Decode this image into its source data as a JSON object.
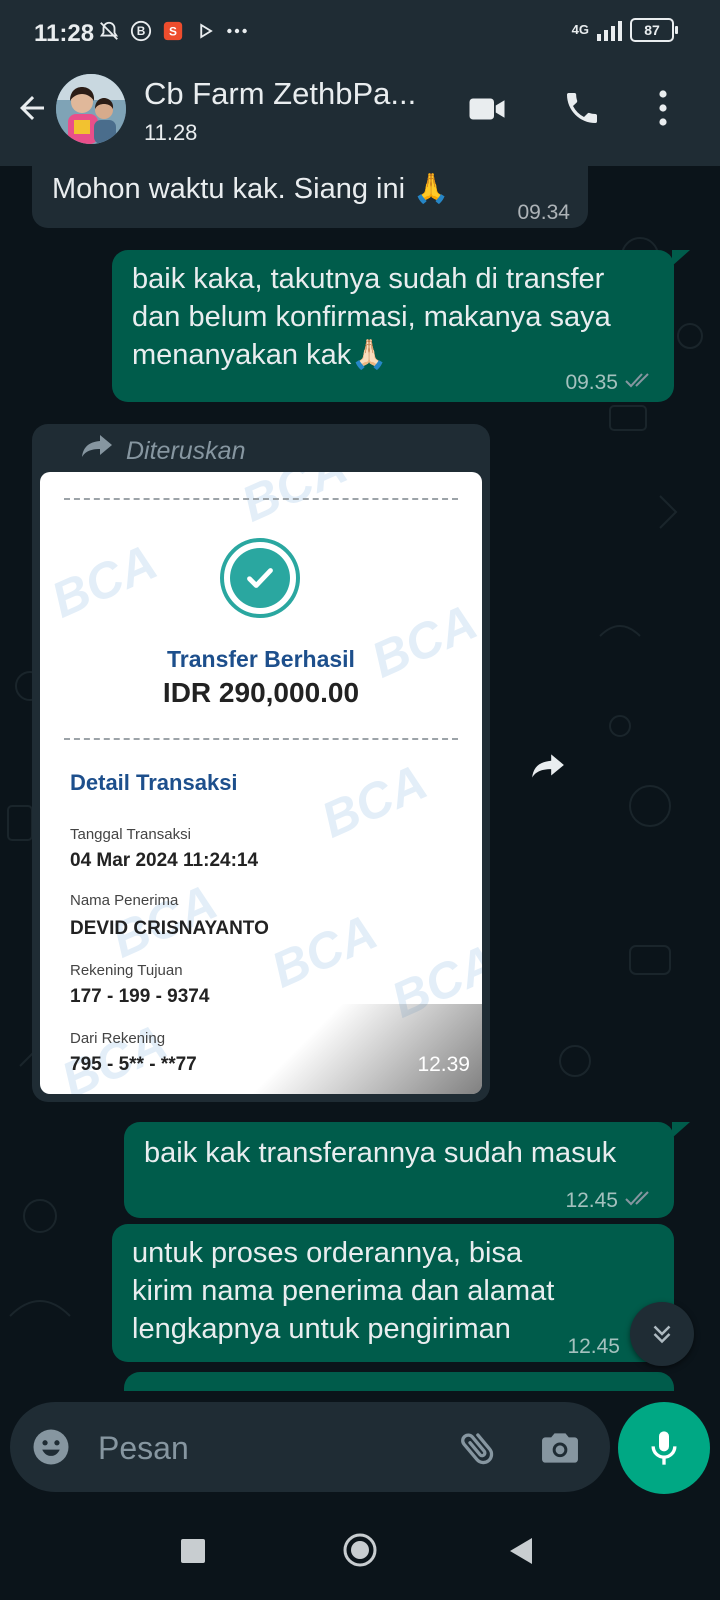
{
  "status_bar": {
    "time": "11:28",
    "network": "4G",
    "battery": "87"
  },
  "header": {
    "contact_name": "Cb Farm ZethbPa...",
    "last_seen": "11.28"
  },
  "messages": [
    {
      "direction": "incoming",
      "text": "Mohon waktu kak. Siang ini 🙏",
      "time": "09.34"
    },
    {
      "direction": "outgoing",
      "text": "baik kaka, takutnya sudah di transfer\ndan belum konfirmasi, makanya saya\nmenanyakan kak🙏🏻",
      "time": "09.35",
      "status": "read"
    },
    {
      "direction": "outgoing",
      "text": "baik kak transferannya sudah masuk",
      "time": "12.45",
      "status": "read"
    },
    {
      "direction": "outgoing",
      "text": "untuk proses orderannya, bisa\nkirim nama penerima dan alamat\nlengkapnya untuk pengiriman",
      "time": "12.45"
    }
  ],
  "forwarded_image": {
    "forwarded_label": "Diteruskan",
    "time": "12.39",
    "receipt": {
      "watermark": "BCA",
      "title": "Transfer Berhasil",
      "amount": "IDR 290,000.00",
      "section": "Detail Transaksi",
      "fields": [
        {
          "label": "Tanggal Transaksi",
          "value": "04 Mar 2024 11:24:14"
        },
        {
          "label": "Nama Penerima",
          "value": "DEVID CRISNAYANTO"
        },
        {
          "label": "Rekening Tujuan",
          "value": "177 - 199 - 9374"
        },
        {
          "label": "Dari Rekening",
          "value": "795 - 5** - **77"
        }
      ]
    }
  },
  "composer": {
    "placeholder": "Pesan"
  },
  "icons": {
    "back": "arrow-left-icon",
    "video": "video-camera-icon",
    "call": "phone-icon",
    "menu": "more-vertical-icon",
    "emoji": "emoji-icon",
    "attach": "paperclip-icon",
    "camera": "camera-icon",
    "mic": "microphone-icon",
    "scroll_down": "double-chevron-down-icon"
  },
  "colors": {
    "header_bg": "#1f2c34",
    "chat_bg": "#0b141a",
    "outgoing_bubble": "#005c4b",
    "incoming_bubble": "#1f2c34",
    "accent": "#00a884",
    "read_ticks": "#8696a0"
  }
}
